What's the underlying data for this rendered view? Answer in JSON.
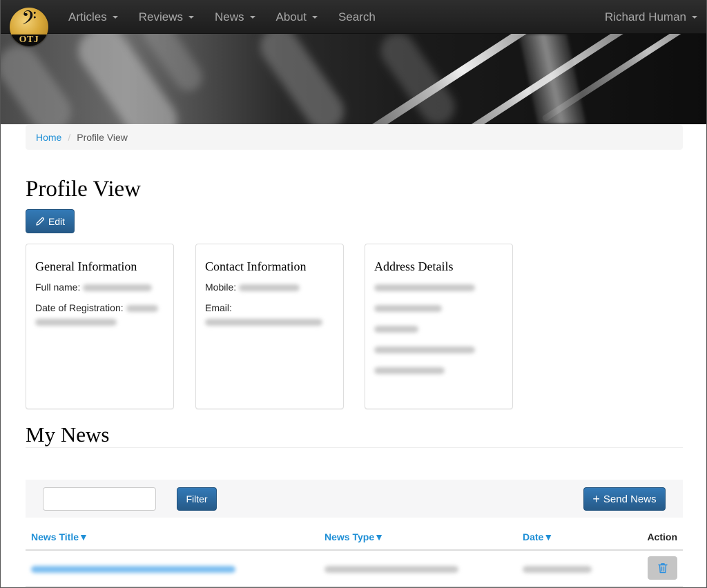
{
  "navbar": {
    "logo_text": "OTJ",
    "logo_glyph": "𝄢",
    "items": [
      {
        "label": "Articles",
        "has_dropdown": true
      },
      {
        "label": "Reviews",
        "has_dropdown": true
      },
      {
        "label": "News",
        "has_dropdown": true
      },
      {
        "label": "About",
        "has_dropdown": true
      },
      {
        "label": "Search",
        "has_dropdown": false
      }
    ],
    "user": {
      "label": "Richard Human",
      "has_dropdown": true
    }
  },
  "breadcrumb": {
    "home": "Home",
    "separator": "/",
    "current": "Profile View"
  },
  "page": {
    "title": "Profile View",
    "edit_label": "Edit"
  },
  "cards": {
    "general": {
      "title": "General Information",
      "full_name_label": "Full name:",
      "full_name_value": "[blurred]",
      "registration_label": "Date of Registration:",
      "registration_value": "[blurred]"
    },
    "contact": {
      "title": "Contact Information",
      "mobile_label": "Mobile:",
      "mobile_value": "[blurred]",
      "email_label": "Email:",
      "email_value": "[blurred]"
    },
    "address": {
      "title": "Address Details",
      "lines": [
        "[blurred]",
        "[blurred]",
        "[blurred]",
        "[blurred]",
        "[blurred]"
      ]
    }
  },
  "news": {
    "title": "My News",
    "filter_placeholder": "",
    "filter_value": "",
    "filter_label": "Filter",
    "send_label": "Send News",
    "columns": {
      "title": "News Title▼",
      "type": "News Type▼",
      "date": "Date▼",
      "action": "Action"
    },
    "rows": [
      {
        "title": "[blurred]",
        "type": "[blurred]",
        "date": "[blurred]"
      }
    ]
  },
  "colors": {
    "link": "#1f8fd6",
    "primary": "#337ab7",
    "navbar": "#222222",
    "delete_bg": "#c5c5c5"
  }
}
